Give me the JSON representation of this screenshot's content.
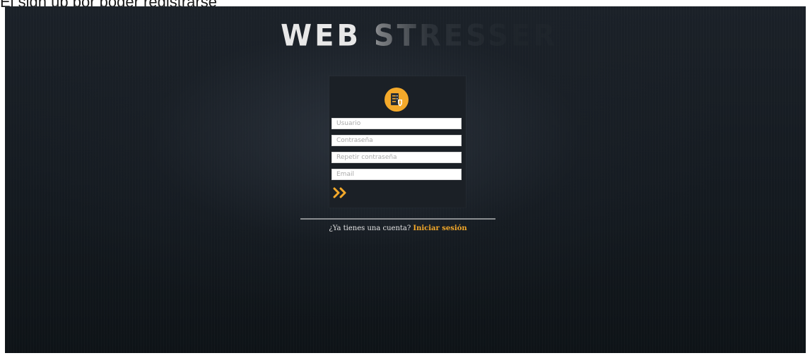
{
  "caption": "El sign up por poder registrarse",
  "logo": {
    "text": "WEB STRESSER"
  },
  "form": {
    "icon": "server-shield-icon",
    "fields": [
      {
        "placeholder": "Usuario",
        "value": ""
      },
      {
        "placeholder": "Contraseña",
        "value": ""
      },
      {
        "placeholder": "Repetir contraseña",
        "value": ""
      },
      {
        "placeholder": "Email",
        "value": ""
      }
    ],
    "submit_icon": "double-chevron-right-icon"
  },
  "footer": {
    "question": "¿Ya tienes una cuenta?",
    "link_label": "Iniciar sesión"
  },
  "colors": {
    "accent": "#f4a92a",
    "background": "#141a20",
    "panel": "#1b2026"
  }
}
